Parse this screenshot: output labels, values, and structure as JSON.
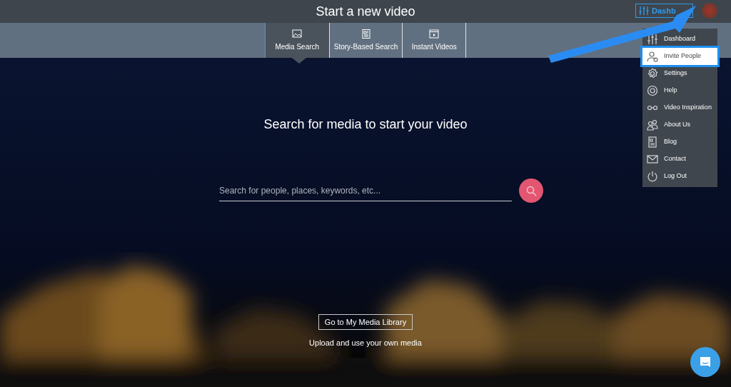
{
  "header": {
    "title": "Start a new video",
    "button": "Dashb"
  },
  "tabs": [
    {
      "label": "Media Search",
      "selected": true
    },
    {
      "label": "Story-Based Search",
      "selected": false
    },
    {
      "label": "Instant Videos",
      "selected": false
    }
  ],
  "heading": "Search for media to start your video",
  "search": {
    "placeholder": "Search for people, places, keywords, etc..."
  },
  "library_button": "Go to My Media Library",
  "library_caption": "Upload and use your own media",
  "user_menu": [
    {
      "label": "Dashboard",
      "selected": false
    },
    {
      "label": "Invite People",
      "selected": true
    },
    {
      "label": "Settings",
      "selected": false
    },
    {
      "label": "Help",
      "selected": false
    },
    {
      "label": "Video Inspiration",
      "selected": false
    },
    {
      "label": "About Us",
      "selected": false
    },
    {
      "label": "Blog",
      "selected": false
    },
    {
      "label": "Contact",
      "selected": false
    },
    {
      "label": "Log Out",
      "selected": false
    }
  ]
}
